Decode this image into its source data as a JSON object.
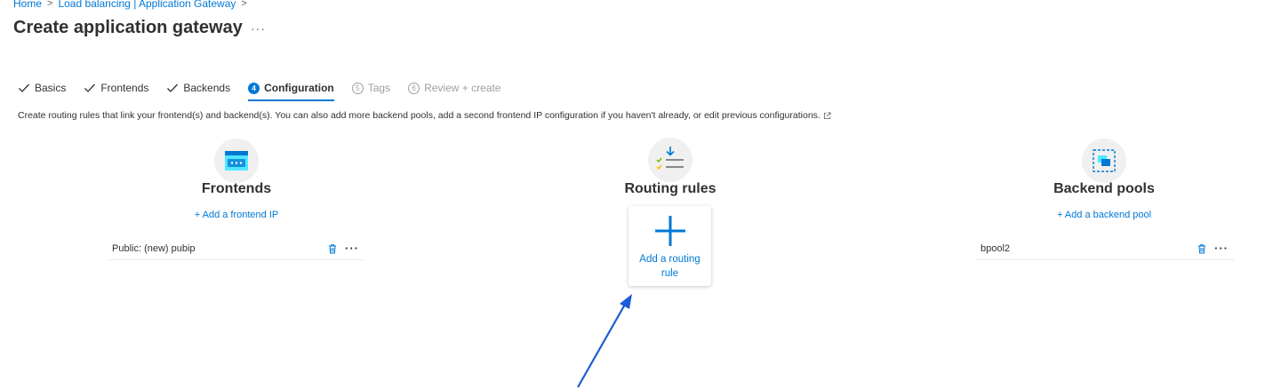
{
  "breadcrumb": {
    "home": "Home",
    "parent": "Load balancing | Application Gateway"
  },
  "title": "Create application gateway",
  "more": "···",
  "steps": [
    {
      "label": "Basics",
      "state": "done"
    },
    {
      "label": "Frontends",
      "state": "done"
    },
    {
      "label": "Backends",
      "state": "done"
    },
    {
      "num": "4",
      "label": "Configuration",
      "state": "active"
    },
    {
      "num": "5",
      "label": "Tags",
      "state": "disabled"
    },
    {
      "num": "6",
      "label": "Review + create",
      "state": "disabled"
    }
  ],
  "description": "Create routing rules that link your frontend(s) and backend(s). You can also add more backend pools, add a second frontend IP configuration if you haven't already, or edit previous configurations.",
  "frontends": {
    "heading": "Frontends",
    "add_link": "+ Add a frontend IP",
    "items": [
      {
        "label": "Public: (new) pubip"
      }
    ]
  },
  "routing": {
    "heading": "Routing rules",
    "add_label": "Add a routing rule"
  },
  "backends": {
    "heading": "Backend pools",
    "add_link": "+ Add a backend pool",
    "items": [
      {
        "label": "bpool2"
      }
    ]
  },
  "colors": {
    "accent": "#0078d4",
    "arrow": "#1e5bd6"
  }
}
